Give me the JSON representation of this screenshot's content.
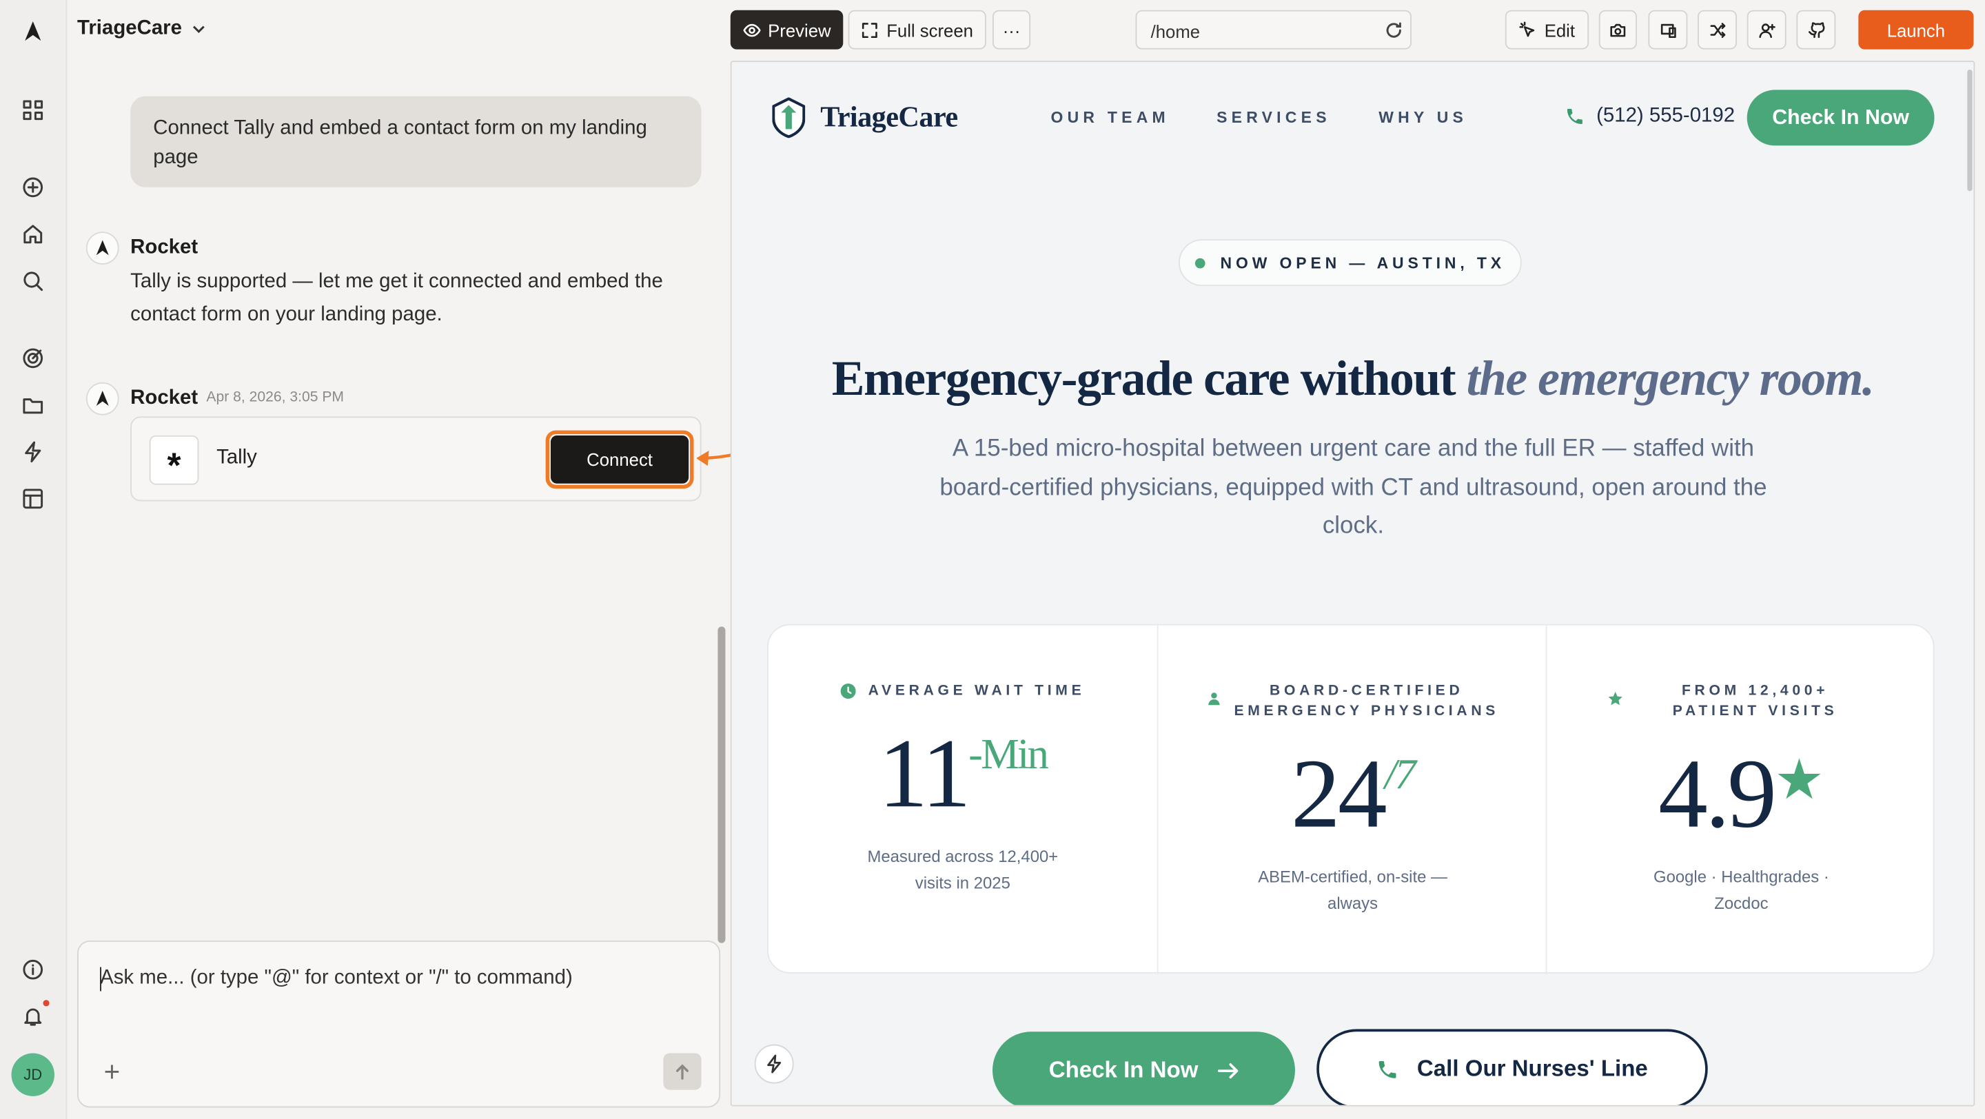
{
  "project": {
    "name": "TriageCare"
  },
  "chat": {
    "user_message": "Connect Tally and embed a contact form on my landing page",
    "assistant_name": "Rocket",
    "assistant_reply": "Tally is supported — let me get it connected and embed the contact form on your landing page.",
    "second_timestamp": "Apr 8, 2026, 3:05 PM",
    "integration": {
      "name": "Tally",
      "logo_glyph": "*",
      "button_label": "Connect"
    },
    "composer_placeholder": "Ask me... (or type \"@\" for context or \"/\" to command)"
  },
  "toolbar": {
    "preview": "Preview",
    "fullscreen": "Full screen",
    "more": "···",
    "url": "/home",
    "edit": "Edit",
    "launch": "Launch"
  },
  "user": {
    "initials": "JD"
  },
  "site": {
    "brand": "TriageCare",
    "nav": [
      "OUR TEAM",
      "SERVICES",
      "WHY US"
    ],
    "phone": "(512) 555-0192",
    "header_cta": "Check In Now",
    "badge": "NOW OPEN — AUSTIN, TX",
    "headline_plain": "Emergency-grade care without ",
    "headline_italic": "the emergency room.",
    "subhead": "A 15-bed micro-hospital between urgent care and the full ER — staffed with board-certified physicians, equipped with CT and ultrasound, open around the clock.",
    "stats": [
      {
        "label": "AVERAGE WAIT TIME",
        "value": "11",
        "suffix": "-Min",
        "desc": "Measured across 12,400+ visits in 2025",
        "icon": "clock-icon"
      },
      {
        "label": "BOARD-CERTIFIED EMERGENCY PHYSICIANS",
        "value": "24",
        "suffix": "/7",
        "desc": "ABEM-certified, on-site — always",
        "icon": "physician-icon"
      },
      {
        "label": "FROM 12,400+ PATIENT VISITS",
        "value": "4.9",
        "suffix": "★",
        "desc": "Google · Healthgrades · Zocdoc",
        "icon": "star-icon"
      }
    ],
    "cta_primary": "Check In Now",
    "cta_secondary": "Call Our Nurses' Line"
  },
  "colors": {
    "accent_green": "#4aa779",
    "navy": "#142844",
    "launch_orange": "#e85d1c",
    "highlight_orange": "#f07b26"
  }
}
